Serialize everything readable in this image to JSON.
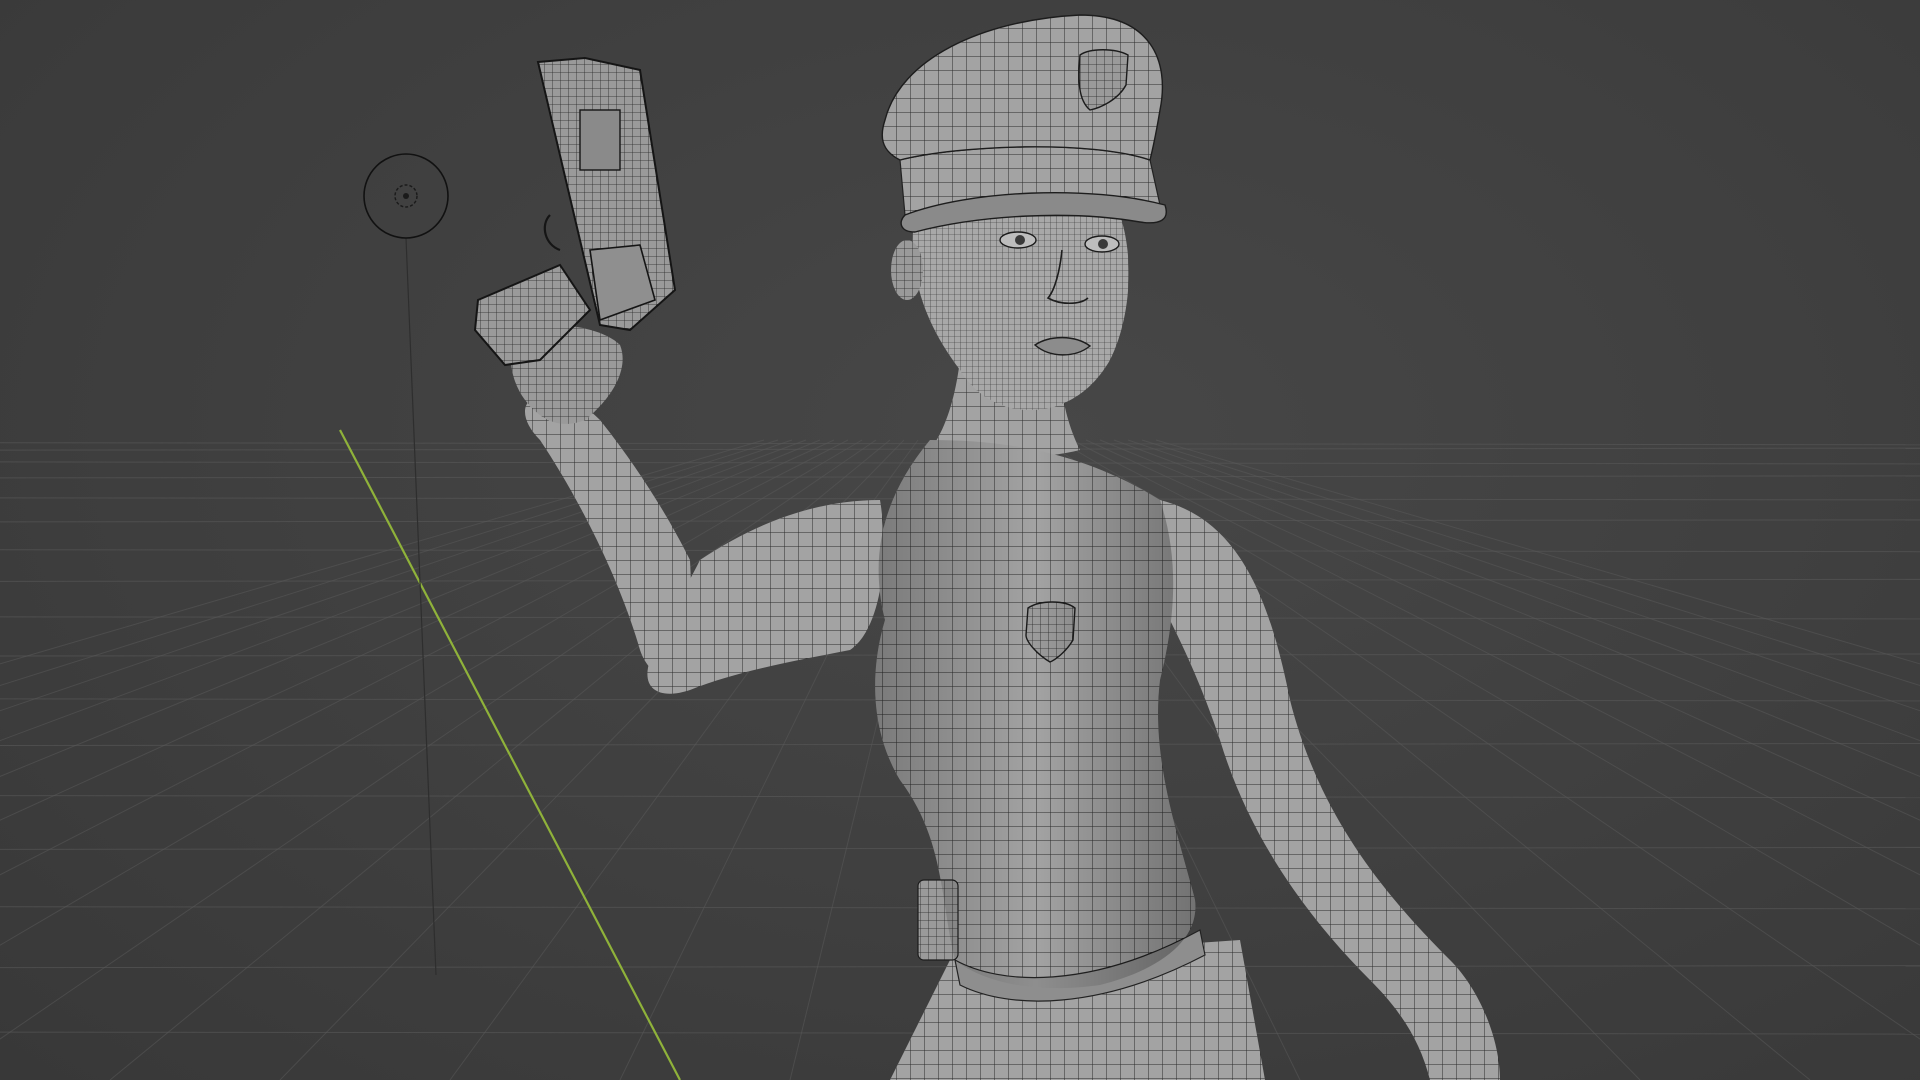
{
  "viewport": {
    "background_color": "#3d3d3d",
    "grid_color": "#5a5a5a",
    "y_axis_color": "#8fb23a",
    "mesh_fill": "#9d9d9d",
    "wire_color": "#2a2a2a"
  },
  "scene": {
    "objects": [
      {
        "name": "light-object"
      },
      {
        "name": "character-mesh"
      },
      {
        "name": "pistol-mesh"
      }
    ]
  }
}
